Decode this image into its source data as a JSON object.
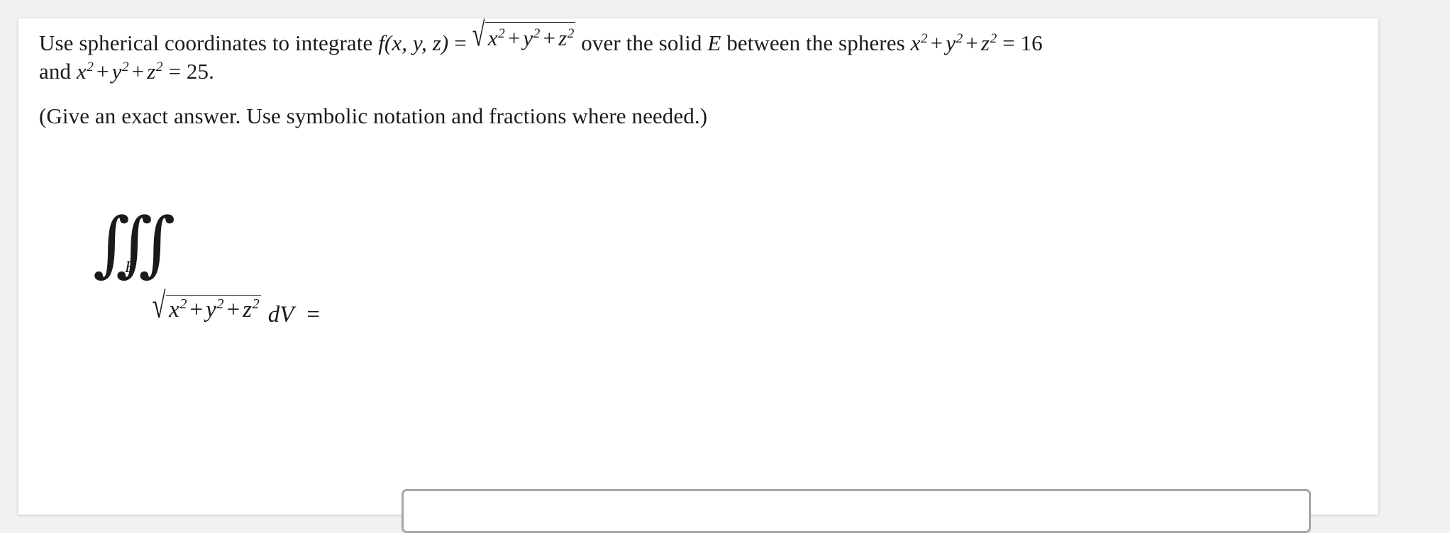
{
  "page": {
    "background_color": "#f1f1f1",
    "card_background_color": "#ffffff",
    "text_color": "#1a1a1a"
  },
  "problem": {
    "lead_text": "Use spherical coordinates to integrate ",
    "function_name": "f",
    "function_args": "(x, y, z)",
    "equals": " = ",
    "radicand_x": "x",
    "radicand_y": "y",
    "radicand_z": "z",
    "exponent": "2",
    "plus": "+",
    "mid_text": " over the solid ",
    "solid_symbol": "E",
    "mid_text_2": " between the spheres ",
    "sphere_1_value": "= 16",
    "conjunction": " and ",
    "sphere_2_value": "= 25.",
    "full_text": "Use spherical coordinates to integrate f(x, y, z) = sqrt(x^2 + y^2 + z^2) over the solid E between the spheres x^2 + y^2 + z^2 = 16 and x^2 + y^2 + z^2 = 25."
  },
  "instructions": {
    "text": "(Give an exact answer. Use symbolic notation and fractions where needed.)"
  },
  "formula": {
    "integral_glyph": "∫∫∫",
    "integral_limit": "E",
    "radical_sign": "√",
    "var_x": "x",
    "var_y": "y",
    "var_z": "z",
    "exponent": "2",
    "plus": "+",
    "differential": "dV",
    "equals": "="
  },
  "answer_field": {
    "value": "",
    "placeholder": "",
    "border_color": "#a6a6a6"
  }
}
